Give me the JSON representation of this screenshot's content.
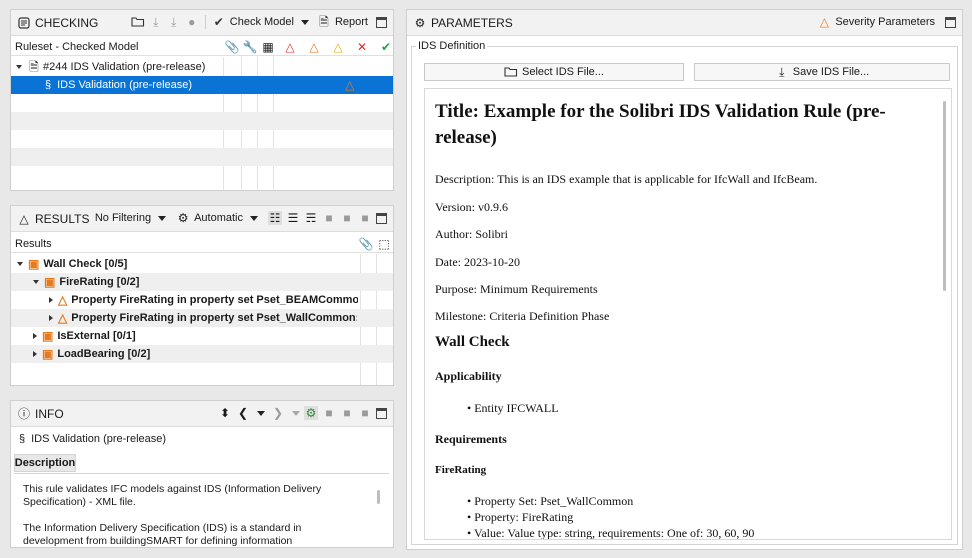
{
  "checking": {
    "title": "CHECKING",
    "check_model_label": "Check Model",
    "report_label": "Report",
    "columns": {
      "ruleset": "Ruleset - Checked Model"
    },
    "rows": [
      {
        "label": "#244 IDS Validation (pre-release)"
      },
      {
        "label": "IDS Validation (pre-release)"
      }
    ]
  },
  "results": {
    "title": "RESULTS",
    "filter_label": "No Filtering",
    "automatic_label": "Automatic",
    "column_header": "Results",
    "rows": [
      {
        "label": "Wall Check [0/5]"
      },
      {
        "label": "FireRating [0/2]"
      },
      {
        "label": "Property FireRating in property set Pset_BEAMCommon: numb"
      },
      {
        "label": "Property FireRating in property set Pset_WallCommon: numbe"
      },
      {
        "label": "IsExternal [0/1]"
      },
      {
        "label": "LoadBearing [0/2]"
      }
    ]
  },
  "info": {
    "title": "INFO",
    "rule_name": "IDS Validation (pre-release)",
    "tab_label": "Description",
    "description_p1": "This rule validates IFC models against IDS (Information Delivery Specification) - XML file.",
    "description_p2": "The Information Delivery Specification (IDS) is a standard in development from buildingSMART for defining information requirements in a way that is"
  },
  "parameters": {
    "title": "PARAMETERS",
    "severity_label": "Severity Parameters",
    "group_label": "IDS Definition",
    "select_button": "Select IDS File...",
    "save_button": "Save IDS File...",
    "doc": {
      "title": "Title: Example for the Solibri IDS Validation Rule (pre-release)",
      "description": "Description: This is an IDS example that is applicable for IfcWall and IfcBeam.",
      "version": "Version: v0.9.6",
      "author": "Author: Solibri",
      "date": "Date: 2023-10-20",
      "purpose": "Purpose: Minimum Requirements",
      "milestone": "Milestone: Criteria Definition Phase",
      "section": "Wall Check",
      "applicability": "Applicability",
      "entity": "Entity IFCWALL",
      "requirements": "Requirements",
      "firerating": "FireRating",
      "pset": "Property Set: Pset_WallCommon",
      "property": "Property: FireRating",
      "value": "Value: Value type: string, requirements: One of: 30, 60, 90"
    }
  },
  "colors": {
    "selection": "#0a74d6",
    "warning": "#e87a1e",
    "error": "#e0302c",
    "ok": "#1aa34a"
  }
}
